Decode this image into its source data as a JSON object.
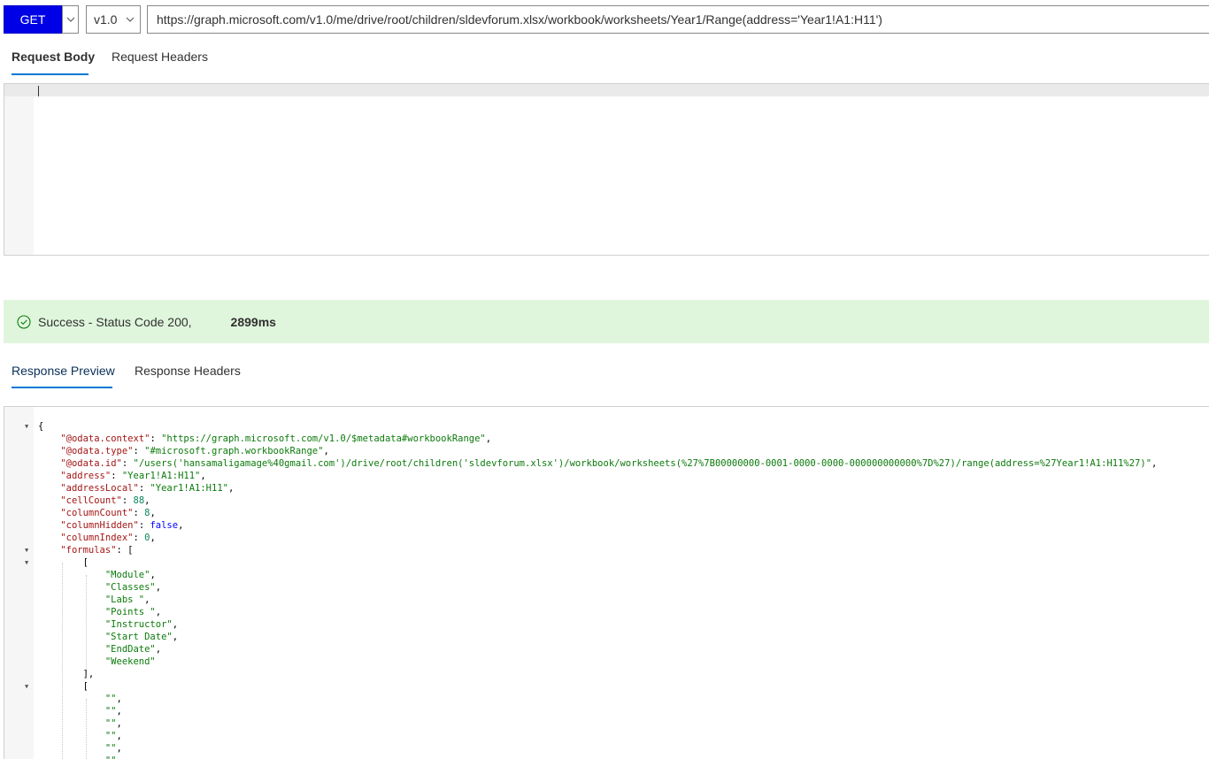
{
  "request": {
    "method": "GET",
    "version": "v1.0",
    "url": "https://graph.microsoft.com/v1.0/me/drive/root/children/sldevforum.xlsx/workbook/worksheets/Year1/Range(address='Year1!A1:H11')"
  },
  "request_tabs": [
    "Request Body",
    "Request Headers"
  ],
  "status": {
    "text": "Success - Status Code 200,",
    "duration": "2899ms"
  },
  "response_tabs": [
    "Response Preview",
    "Response Headers"
  ],
  "response_lines": [
    {
      "fold": true,
      "indent": 0,
      "parts": [
        {
          "t": "p",
          "v": "{"
        }
      ]
    },
    {
      "fold": false,
      "indent": 1,
      "parts": [
        {
          "t": "k",
          "v": "\"@odata.context\""
        },
        {
          "t": "p",
          "v": ": "
        },
        {
          "t": "s",
          "v": "\"https://graph.microsoft.com/v1.0/$metadata#workbookRange\""
        },
        {
          "t": "p",
          "v": ","
        }
      ]
    },
    {
      "fold": false,
      "indent": 1,
      "parts": [
        {
          "t": "k",
          "v": "\"@odata.type\""
        },
        {
          "t": "p",
          "v": ": "
        },
        {
          "t": "s",
          "v": "\"#microsoft.graph.workbookRange\""
        },
        {
          "t": "p",
          "v": ","
        }
      ]
    },
    {
      "fold": false,
      "indent": 1,
      "parts": [
        {
          "t": "k",
          "v": "\"@odata.id\""
        },
        {
          "t": "p",
          "v": ": "
        },
        {
          "t": "s",
          "v": "\"/users('hansamaligamage%40gmail.com')/drive/root/children('sldevforum.xlsx')/workbook/worksheets(%27%7B00000000-0001-0000-0000-000000000000%7D%27)/range(address=%27Year1!A1:H11%27)\""
        },
        {
          "t": "p",
          "v": ","
        }
      ]
    },
    {
      "fold": false,
      "indent": 1,
      "parts": [
        {
          "t": "k",
          "v": "\"address\""
        },
        {
          "t": "p",
          "v": ": "
        },
        {
          "t": "s",
          "v": "\"Year1!A1:H11\""
        },
        {
          "t": "p",
          "v": ","
        }
      ]
    },
    {
      "fold": false,
      "indent": 1,
      "parts": [
        {
          "t": "k",
          "v": "\"addressLocal\""
        },
        {
          "t": "p",
          "v": ": "
        },
        {
          "t": "s",
          "v": "\"Year1!A1:H11\""
        },
        {
          "t": "p",
          "v": ","
        }
      ]
    },
    {
      "fold": false,
      "indent": 1,
      "parts": [
        {
          "t": "k",
          "v": "\"cellCount\""
        },
        {
          "t": "p",
          "v": ": "
        },
        {
          "t": "n",
          "v": "88"
        },
        {
          "t": "p",
          "v": ","
        }
      ]
    },
    {
      "fold": false,
      "indent": 1,
      "parts": [
        {
          "t": "k",
          "v": "\"columnCount\""
        },
        {
          "t": "p",
          "v": ": "
        },
        {
          "t": "n",
          "v": "8"
        },
        {
          "t": "p",
          "v": ","
        }
      ]
    },
    {
      "fold": false,
      "indent": 1,
      "parts": [
        {
          "t": "k",
          "v": "\"columnHidden\""
        },
        {
          "t": "p",
          "v": ": "
        },
        {
          "t": "b",
          "v": "false"
        },
        {
          "t": "p",
          "v": ","
        }
      ]
    },
    {
      "fold": false,
      "indent": 1,
      "parts": [
        {
          "t": "k",
          "v": "\"columnIndex\""
        },
        {
          "t": "p",
          "v": ": "
        },
        {
          "t": "n",
          "v": "0"
        },
        {
          "t": "p",
          "v": ","
        }
      ]
    },
    {
      "fold": true,
      "indent": 1,
      "parts": [
        {
          "t": "k",
          "v": "\"formulas\""
        },
        {
          "t": "p",
          "v": ": ["
        }
      ]
    },
    {
      "fold": true,
      "indent": 2,
      "parts": [
        {
          "t": "p",
          "v": "["
        }
      ]
    },
    {
      "fold": false,
      "indent": 3,
      "parts": [
        {
          "t": "s",
          "v": "\"Module\""
        },
        {
          "t": "p",
          "v": ","
        }
      ]
    },
    {
      "fold": false,
      "indent": 3,
      "parts": [
        {
          "t": "s",
          "v": "\"Classes\""
        },
        {
          "t": "p",
          "v": ","
        }
      ]
    },
    {
      "fold": false,
      "indent": 3,
      "parts": [
        {
          "t": "s",
          "v": "\"Labs \""
        },
        {
          "t": "p",
          "v": ","
        }
      ]
    },
    {
      "fold": false,
      "indent": 3,
      "parts": [
        {
          "t": "s",
          "v": "\"Points \""
        },
        {
          "t": "p",
          "v": ","
        }
      ]
    },
    {
      "fold": false,
      "indent": 3,
      "parts": [
        {
          "t": "s",
          "v": "\"Instructor\""
        },
        {
          "t": "p",
          "v": ","
        }
      ]
    },
    {
      "fold": false,
      "indent": 3,
      "parts": [
        {
          "t": "s",
          "v": "\"Start Date\""
        },
        {
          "t": "p",
          "v": ","
        }
      ]
    },
    {
      "fold": false,
      "indent": 3,
      "parts": [
        {
          "t": "s",
          "v": "\"EndDate\""
        },
        {
          "t": "p",
          "v": ","
        }
      ]
    },
    {
      "fold": false,
      "indent": 3,
      "parts": [
        {
          "t": "s",
          "v": "\"Weekend\""
        }
      ]
    },
    {
      "fold": false,
      "indent": 2,
      "parts": [
        {
          "t": "p",
          "v": "],"
        }
      ]
    },
    {
      "fold": true,
      "indent": 2,
      "parts": [
        {
          "t": "p",
          "v": "["
        }
      ]
    },
    {
      "fold": false,
      "indent": 3,
      "parts": [
        {
          "t": "s",
          "v": "\"\""
        },
        {
          "t": "p",
          "v": ","
        }
      ]
    },
    {
      "fold": false,
      "indent": 3,
      "parts": [
        {
          "t": "s",
          "v": "\"\""
        },
        {
          "t": "p",
          "v": ","
        }
      ]
    },
    {
      "fold": false,
      "indent": 3,
      "parts": [
        {
          "t": "s",
          "v": "\"\""
        },
        {
          "t": "p",
          "v": ","
        }
      ]
    },
    {
      "fold": false,
      "indent": 3,
      "parts": [
        {
          "t": "s",
          "v": "\"\""
        },
        {
          "t": "p",
          "v": ","
        }
      ]
    },
    {
      "fold": false,
      "indent": 3,
      "parts": [
        {
          "t": "s",
          "v": "\"\""
        },
        {
          "t": "p",
          "v": ","
        }
      ]
    },
    {
      "fold": false,
      "indent": 3,
      "parts": [
        {
          "t": "s",
          "v": "\"\""
        },
        {
          "t": "p",
          "v": ","
        }
      ]
    }
  ],
  "icons": {
    "method_dropdown": "chevron-down-icon",
    "version_dropdown": "chevron-down-icon",
    "status": "check-circle-icon",
    "fold": "caret-down-icon"
  },
  "colors": {
    "method_button": "#0000e6",
    "tab_underline": "#0078d4",
    "status_background": "#dff6dd",
    "status_icon": "#107c10",
    "json_key": "#a31515",
    "json_string": "#0b7a0b",
    "json_number": "#09885a",
    "json_boolean": "#0000ff"
  }
}
